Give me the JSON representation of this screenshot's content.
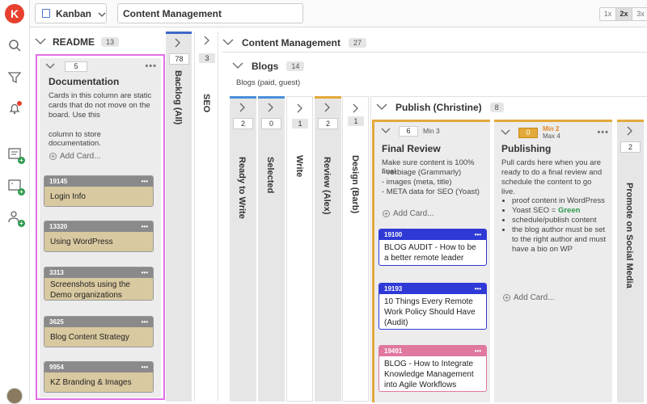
{
  "topbar": {
    "view": "Kanban",
    "board": "Content Management",
    "zoom": [
      "1x",
      "2x",
      "3x"
    ]
  },
  "lanes": {
    "readme": {
      "title": "README",
      "count": "13"
    },
    "backlog": {
      "title": "Backlog (All)",
      "count": "78"
    },
    "seo": {
      "title": "SEO",
      "count": "3"
    }
  },
  "documentation": {
    "title": "Documentation",
    "count": "5",
    "desc1": "Cards in this column are static cards that do not move on the board. Use this",
    "desc2": "column to store documentation.",
    "add": "Add Card...",
    "cards": [
      {
        "id": "19145",
        "title": "Login Info"
      },
      {
        "id": "13320",
        "title": "Using WordPress"
      },
      {
        "id": "3313",
        "title": "Screenshots using the Demo organizations"
      },
      {
        "id": "3625",
        "title": "Blog Content Strategy"
      },
      {
        "id": "9954",
        "title": "KZ Branding & Images"
      }
    ]
  },
  "cm": {
    "title": "Content Management",
    "count": "27"
  },
  "blogs": {
    "title": "Blogs",
    "count": "14",
    "sub": "Blogs (paid, guest)"
  },
  "subcols": [
    {
      "title": "Ready to Write",
      "count": "2"
    },
    {
      "title": "Selected",
      "count": "0"
    },
    {
      "title": "Write",
      "count": "1"
    },
    {
      "title": "Review (Alex)",
      "count": "2"
    },
    {
      "title": "Design (Barb)",
      "count": "1"
    }
  ],
  "publish": {
    "title": "Publish (Christine)",
    "count": "8"
  },
  "finalreview": {
    "title": "Final Review",
    "count": "6",
    "min": "Min 3",
    "desc": "Make sure content is 100% final.",
    "bullets": [
      "- verbiage (Grammarly)",
      "- images (meta, title)",
      "- META data for SEO (Yoast)"
    ],
    "add": "Add Card...",
    "cards": [
      {
        "id": "19100",
        "title": "BLOG AUDIT - How to be a better remote leader"
      },
      {
        "id": "19193",
        "title": "10 Things Every Remote Work Policy Should Have (Audit)"
      },
      {
        "id": "19491",
        "title": "BLOG - How to Integrate Knowledge Management into Agile Workflows"
      }
    ]
  },
  "publishing": {
    "title": "Publishing",
    "count": "0",
    "min": "Min 2",
    "max": "Max 4",
    "desc": "Pull cards here when you are ready to do a final review and schedule the content to go live.",
    "b1": "proof content in WordPress",
    "b2a": "Yoast SEO = ",
    "b2b": "Green",
    "b3": "schedule/publish content",
    "b4": "the blog author must be set to the right author and must have a bio on WP",
    "add": "Add Card..."
  },
  "promote": {
    "title": "Promote on Social Media",
    "count": "2"
  },
  "colors": {
    "accent": "#e8402e",
    "gold": "#e3a93a",
    "blue": "#2f39d6",
    "pink": "#e078a0",
    "card_gray": "#888",
    "card_tan": "#d8c9a0",
    "highlight": "#e26ee6"
  }
}
